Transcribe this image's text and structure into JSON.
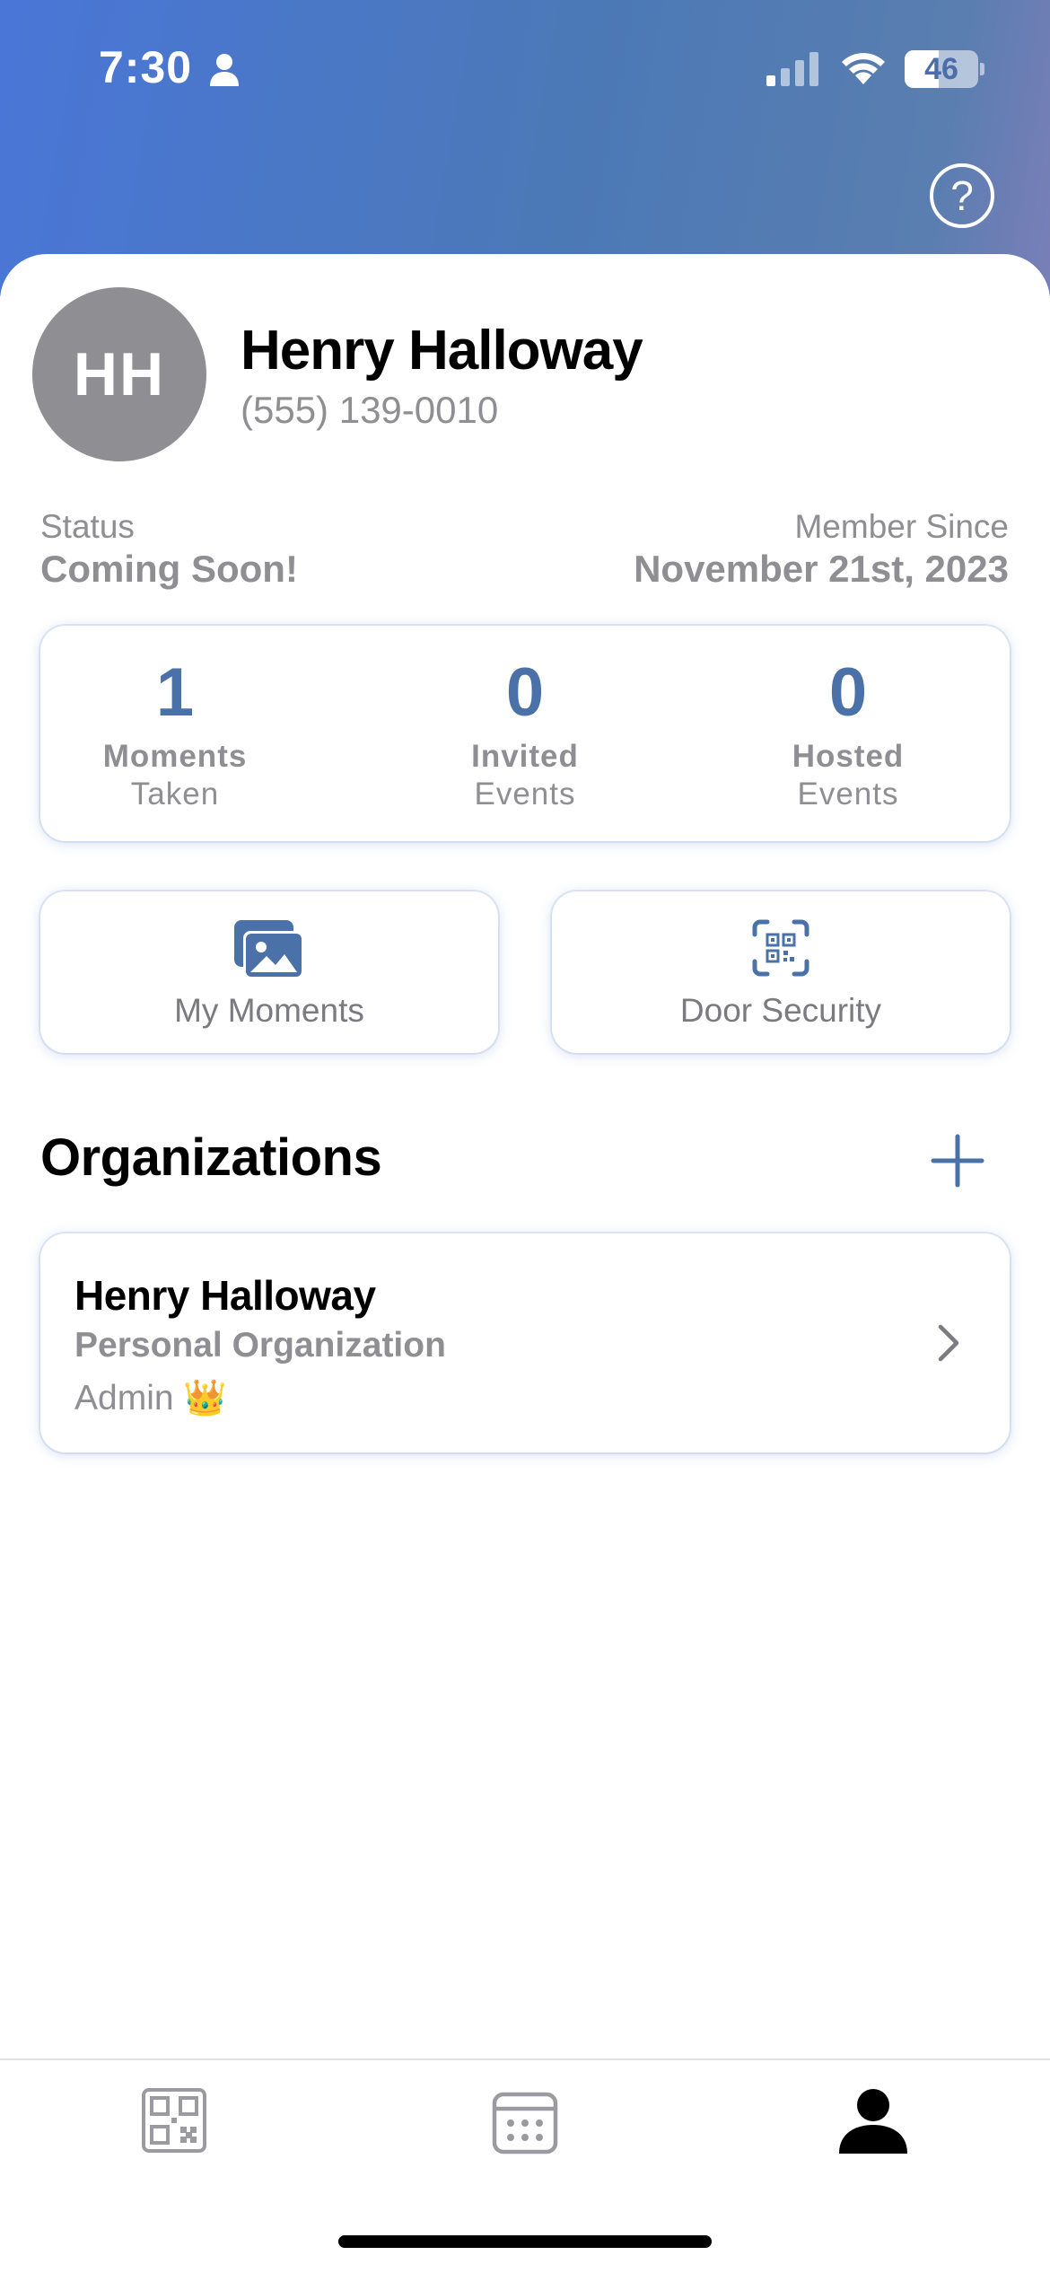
{
  "status_bar": {
    "time": "7:30",
    "battery": "46",
    "battery_level": 0.46
  },
  "profile": {
    "initials": "HH",
    "name": "Henry Halloway",
    "phone": "(555) 139-0010",
    "status_label": "Status",
    "status_value": "Coming Soon!",
    "member_since_label": "Member Since",
    "member_since_value": "November 21st, 2023"
  },
  "stats": [
    {
      "number": "1",
      "label1": "Moments",
      "label2": "Taken"
    },
    {
      "number": "0",
      "label1": "Invited",
      "label2": "Events"
    },
    {
      "number": "0",
      "label1": "Hosted",
      "label2": "Events"
    }
  ],
  "actions": {
    "my_moments": "My Moments",
    "door_security": "Door Security"
  },
  "organizations": {
    "title": "Organizations",
    "items": [
      {
        "name": "Henry Halloway",
        "type": "Personal Organization",
        "role": "Admin 👑"
      }
    ]
  },
  "tabs": [
    {
      "icon": "qr-code-icon"
    },
    {
      "icon": "calendar-icon"
    },
    {
      "icon": "person-icon",
      "active": true
    }
  ],
  "colors": {
    "accent": "#4a72a8",
    "header_start": "#4a76d8",
    "header_end": "#7a7fb8",
    "muted_text": "#8e8e93"
  }
}
